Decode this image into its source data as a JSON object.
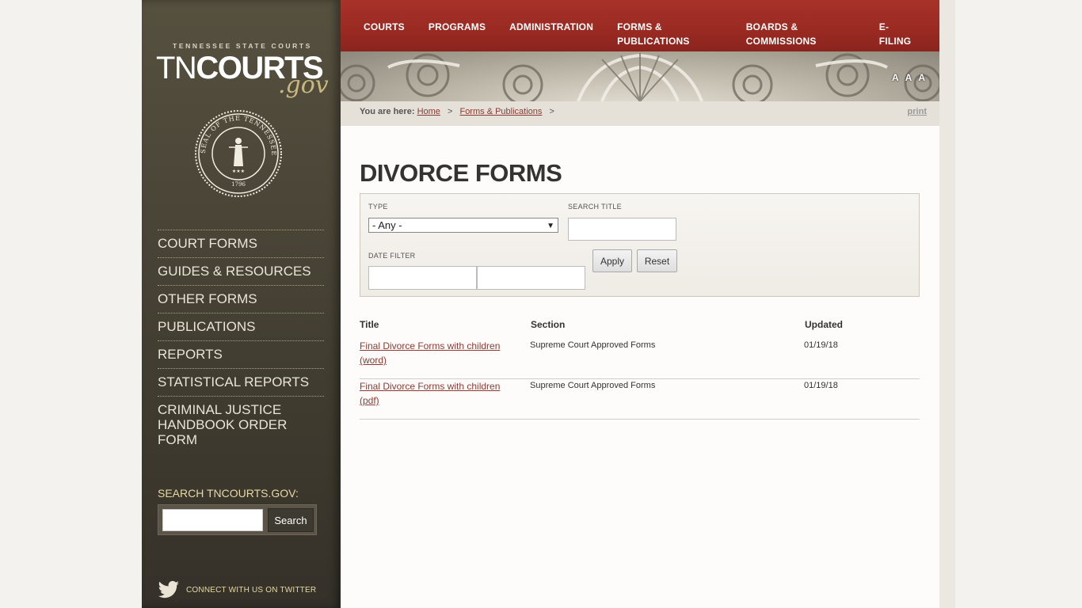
{
  "logo": {
    "top_text": "TENNESSEE STATE COURTS",
    "tn": "TN",
    "courts": "COURTS",
    "gov": ".gov"
  },
  "seal": {
    "label": "SEAL OF THE TENNESSEE JUDICIARY",
    "year": "1796"
  },
  "sidebar": {
    "items": [
      {
        "label": "COURT FORMS"
      },
      {
        "label": "GUIDES & RESOURCES"
      },
      {
        "label": "OTHER FORMS"
      },
      {
        "label": "PUBLICATIONS"
      },
      {
        "label": "REPORTS"
      },
      {
        "label": "STATISTICAL REPORTS"
      },
      {
        "label": "CRIMINAL JUSTICE HANDBOOK ORDER FORM"
      }
    ],
    "search_label": "SEARCH TNCOURTS.GOV:",
    "search_button": "Search",
    "twitter_text": "CONNECT WITH US ON TWITTER"
  },
  "topnav": {
    "items": [
      {
        "label": "COURTS"
      },
      {
        "label": "PROGRAMS"
      },
      {
        "label": "ADMINISTRATION"
      },
      {
        "label": "FORMS & PUBLICATIONS"
      },
      {
        "label": "BOARDS & COMMISSIONS"
      },
      {
        "label": "E-FILING"
      }
    ]
  },
  "font_size_controls": [
    "A",
    "A",
    "A"
  ],
  "breadcrumb": {
    "prefix": "You are here:",
    "items": [
      {
        "label": "Home"
      },
      {
        "label": "Forms & Publications"
      }
    ],
    "separator": ">",
    "print": "print"
  },
  "main": {
    "title": "DIVORCE FORMS",
    "filter": {
      "type_label": "TYPE",
      "type_selected": "- Any -",
      "search_title_label": "SEARCH TITLE",
      "date_filter_label": "DATE FILTER",
      "apply": "Apply",
      "reset": "Reset"
    },
    "table": {
      "headers": [
        "Title",
        "Section",
        "Updated"
      ],
      "rows": [
        {
          "title": "Final Divorce Forms with children (word)",
          "section": "Supreme Court Approved Forms",
          "updated": "01/19/18"
        },
        {
          "title": "Final Divorce Forms with children (pdf)",
          "section": "Supreme Court Approved Forms",
          "updated": "01/19/18"
        }
      ]
    }
  },
  "colors": {
    "nav_red": "#a8322a",
    "sidebar_dark": "#4a4537",
    "link": "#8a3b34",
    "gov_gold": "#c9b87e"
  }
}
